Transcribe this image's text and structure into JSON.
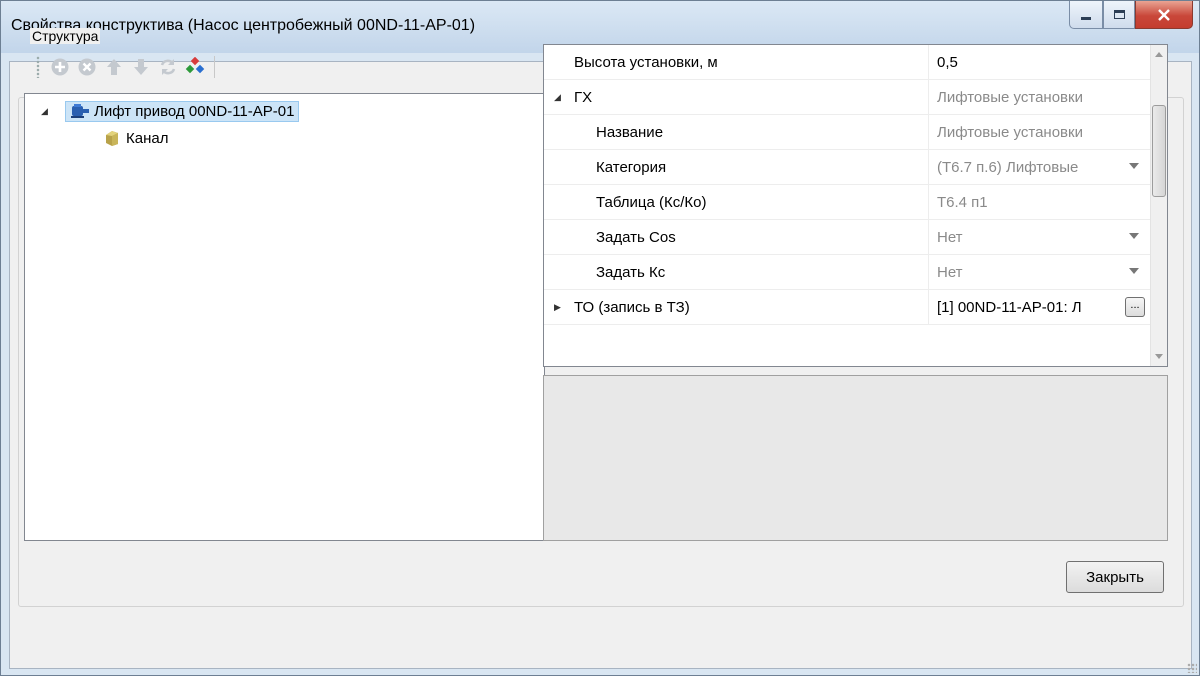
{
  "window": {
    "title": "Свойства конструктива (Насос центробежный 00ND-11-AP-01)"
  },
  "structure": {
    "label": "Структура",
    "toolbar": [
      "add-icon",
      "remove-icon",
      "move-up-icon",
      "move-down-icon",
      "refresh-icon",
      "colors-icon"
    ],
    "tree": {
      "root_label": "Лифт привод 00ND-11-AP-01",
      "child_label": "Канал"
    }
  },
  "properties": {
    "rows": [
      {
        "name": "Высота установки, м",
        "value": "0,5"
      },
      {
        "name": "ГХ",
        "value": "Лифтовые установки"
      },
      {
        "name": "Название",
        "value": "Лифтовые установки"
      },
      {
        "name": "Категория",
        "value": "(Т6.7 п.6) Лифтовые"
      },
      {
        "name": "Таблица (Кс/Ко)",
        "value": "Т6.4 п1"
      },
      {
        "name": "Задать Cos",
        "value": "Нет"
      },
      {
        "name": "Задать Кс",
        "value": "Нет"
      },
      {
        "name": "ТО (запись в ТЗ)",
        "value": "[1] 00ND-11-AP-01: Л"
      }
    ],
    "ellipsis": "..."
  },
  "footer": {
    "close_label": "Закрыть"
  }
}
